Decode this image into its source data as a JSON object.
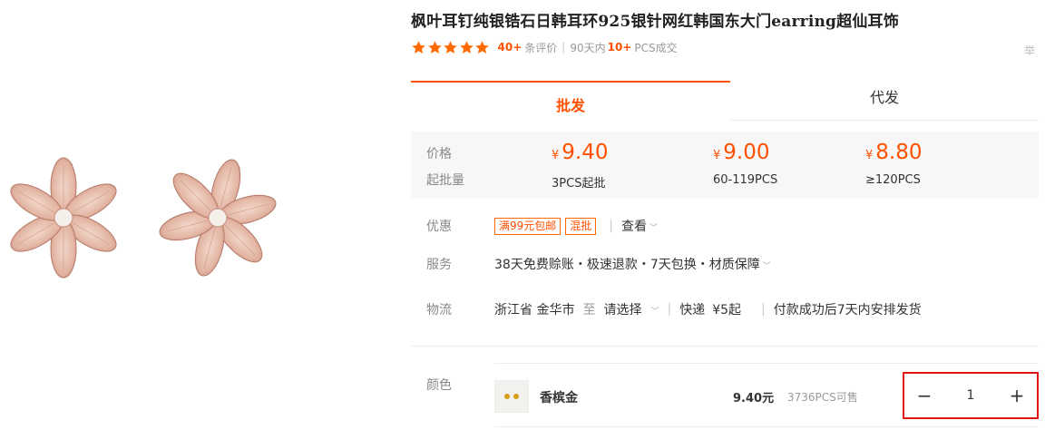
{
  "product": {
    "title": "枫叶耳钉纯银锆石日韩耳环925银针网红韩国东大门earring超仙耳饰",
    "rating": {
      "stars": 5,
      "review_count": "40+",
      "review_label": "条评价",
      "recent_prefix": "90天内",
      "sold_count": "10+",
      "sold_label": "PCS成交"
    },
    "report_label": "举"
  },
  "tabs": [
    {
      "label": "批发",
      "active": true
    },
    {
      "label": "代发",
      "active": false
    }
  ],
  "price_table": {
    "price_label": "价格",
    "moq_label": "起批量",
    "currency": "¥",
    "tiers": [
      {
        "price": "9.40",
        "qty": "3PCS起批"
      },
      {
        "price": "9.00",
        "qty": "60-119PCS"
      },
      {
        "price": "8.80",
        "qty": "≥120PCS"
      }
    ]
  },
  "promo": {
    "label": "优惠",
    "tags": [
      "满99元包邮",
      "混批"
    ],
    "view_label": "查看"
  },
  "service": {
    "label": "服务",
    "text": "38天免费赊账・极速退款・7天包换・材质保障"
  },
  "logistics": {
    "label": "物流",
    "origin": "浙江省 金华市",
    "to_label": "至",
    "dest": "请选择",
    "express": "快递",
    "fee": "¥5起",
    "ship_note": "付款成功后7天内安排发货"
  },
  "sku": {
    "label": "颜色",
    "name": "香槟金",
    "price": "9.40元",
    "stock": "3736PCS可售",
    "quantity": "1"
  },
  "colors": {
    "accent": "#ff5000",
    "star": "#ff6a00",
    "stepper_highlight": "#e01515",
    "earring_rose_gold": "#e3b5a3"
  },
  "icons": {
    "star": "star-icon",
    "caret": "chevron-down-icon",
    "minus": "minus-icon",
    "plus": "plus-icon"
  }
}
